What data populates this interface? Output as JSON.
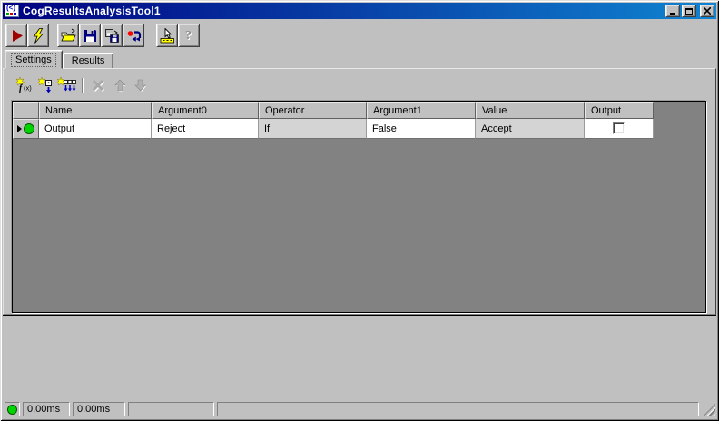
{
  "window": {
    "title": "CogResultsAnalysisTool1",
    "controls": [
      {
        "id": "minimize",
        "icon": "minimize-icon"
      },
      {
        "id": "maximize",
        "icon": "maximize-icon"
      },
      {
        "id": "close",
        "icon": "close-icon"
      }
    ]
  },
  "toolbar": {
    "buttons": [
      {
        "id": "run",
        "icon": "run-icon"
      },
      {
        "id": "live-run",
        "icon": "lightning-icon"
      },
      {
        "id": "open-file",
        "icon": "open-folder-icon"
      },
      {
        "id": "save",
        "icon": "floppy-icon"
      },
      {
        "id": "save-copy",
        "icon": "floppy-copy-icon"
      },
      {
        "id": "reset",
        "icon": "reset-arrow-icon"
      },
      {
        "id": "pointer-tool",
        "icon": "cursor-ruler-icon"
      },
      {
        "id": "help",
        "icon": "question-icon",
        "disabled": true
      }
    ]
  },
  "tabs": [
    {
      "label": "Settings",
      "active": true
    },
    {
      "label": "Results",
      "active": false
    }
  ],
  "grid_toolbar": {
    "buttons": [
      {
        "id": "add-function",
        "icon": "new-function-icon"
      },
      {
        "id": "add-input",
        "icon": "new-input-icon"
      },
      {
        "id": "add-all-inputs",
        "icon": "new-inputs-icon"
      },
      {
        "id": "delete",
        "icon": "delete-x-icon",
        "disabled": true
      },
      {
        "id": "move-up",
        "icon": "arrow-up-icon",
        "disabled": true
      },
      {
        "id": "move-down",
        "icon": "arrow-down-icon",
        "disabled": true
      }
    ]
  },
  "grid": {
    "columns": [
      "Name",
      "Argument0",
      "Operator",
      "Argument1",
      "Value",
      "Output"
    ],
    "row": {
      "indicator": "current-row",
      "status_led": "green",
      "name": "Output",
      "argument0": "Reject",
      "operator": "If",
      "argument1": "False",
      "value": "Accept",
      "output_checked": false
    }
  },
  "status_bar": {
    "led": "green",
    "timer1": "0.00ms",
    "timer2": "0.00ms",
    "panel3": "",
    "panel4": ""
  },
  "colors": {
    "title_gradient_start": "#000080",
    "title_gradient_end": "#1084d0",
    "window_face": "#c0c0c0",
    "grid_background": "#828282",
    "readonly_cell": "#d4d4d4",
    "led_green": "#00d400"
  }
}
